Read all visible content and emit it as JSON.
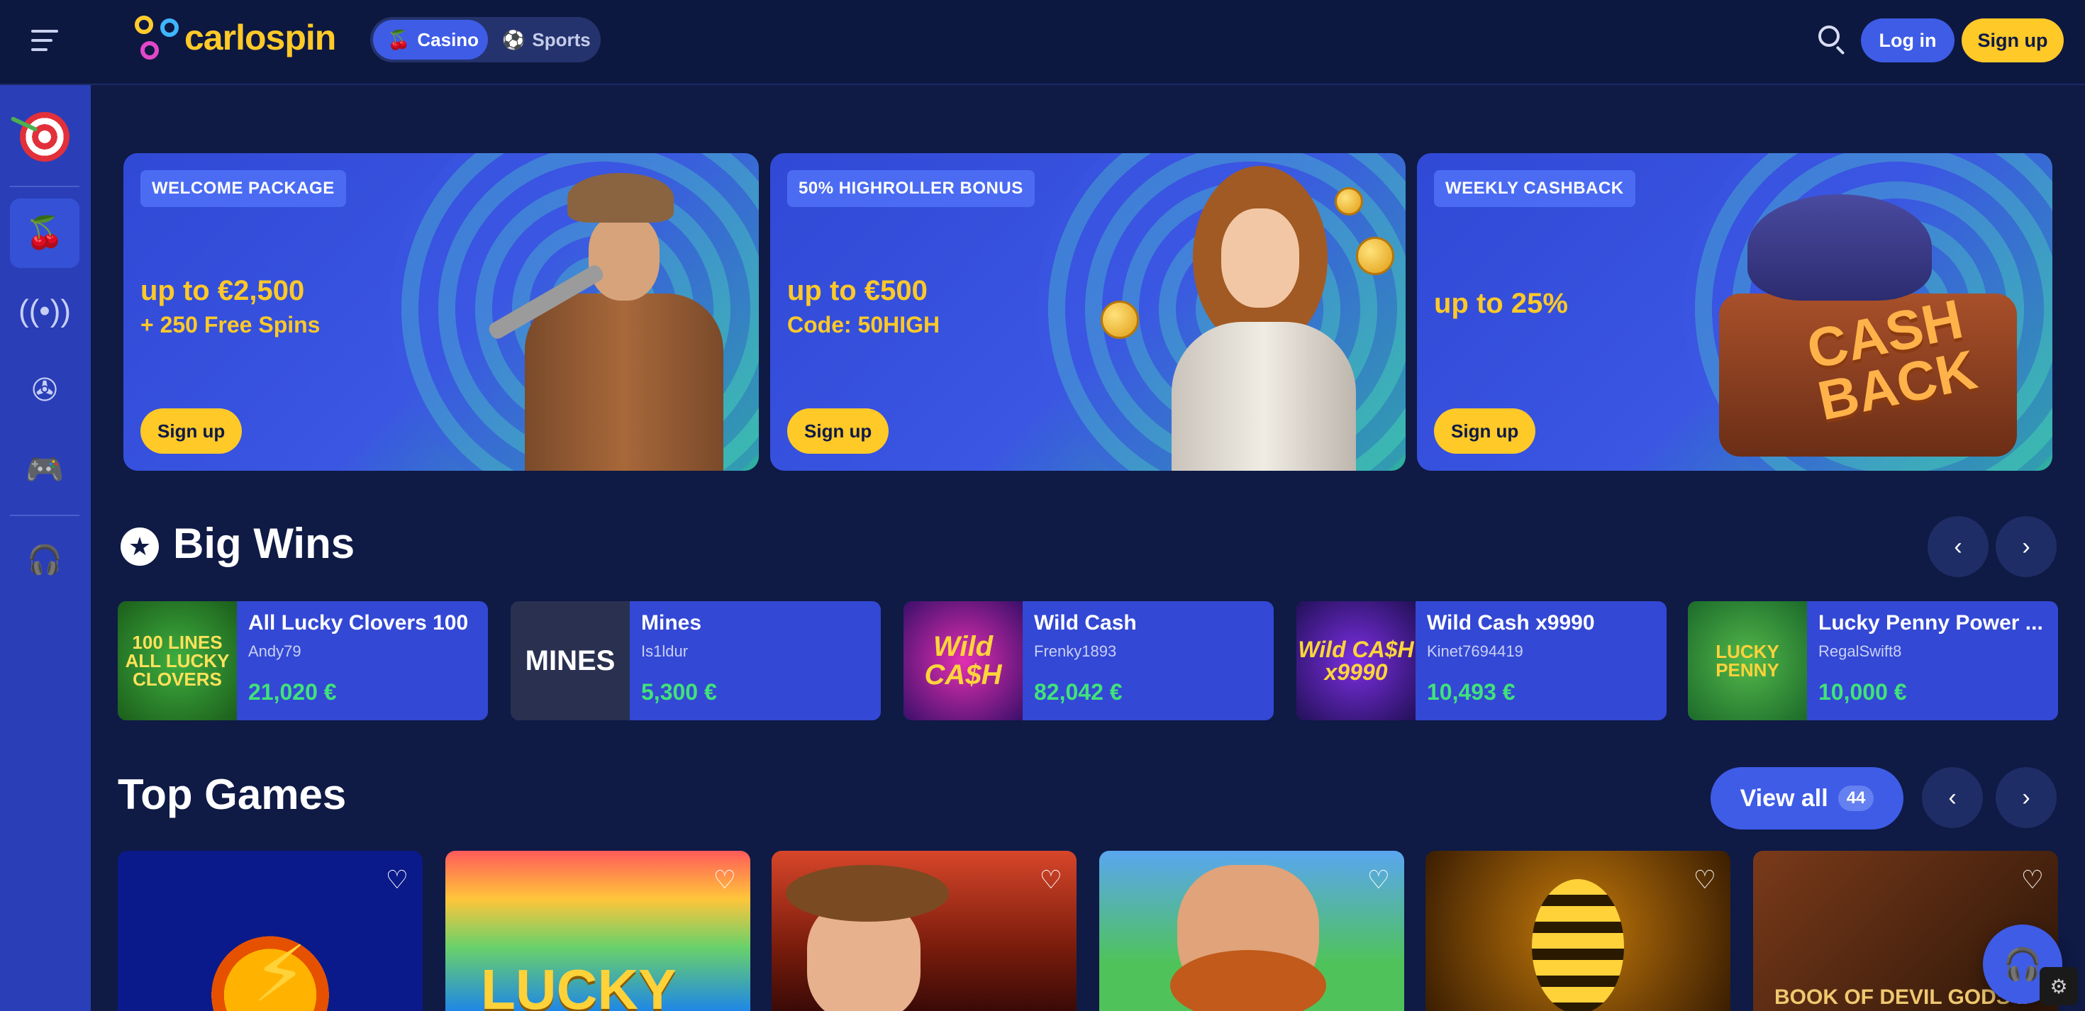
{
  "header": {
    "logo_text": "carlospin",
    "modes": [
      {
        "label": "Casino",
        "icon": "cherry-icon",
        "active": true
      },
      {
        "label": "Sports",
        "icon": "soccer-ball-icon",
        "active": false
      }
    ],
    "login_label": "Log in",
    "signup_label": "Sign up"
  },
  "sidebar": {
    "items": [
      {
        "icon": "darts-target-icon"
      },
      {
        "icon": "cherry-icon",
        "active": true
      },
      {
        "icon": "live-broadcast-icon"
      },
      {
        "icon": "film-reel-icon"
      },
      {
        "icon": "gamepad-icon"
      },
      {
        "icon": "headset-icon"
      }
    ]
  },
  "promos": [
    {
      "tag": "WELCOME PACKAGE",
      "amount": "up to €2,500",
      "sub": "+ 250 Free Spins",
      "cta": "Sign up"
    },
    {
      "tag": "50% HIGHROLLER BONUS",
      "amount": "up to €500",
      "sub": "Code: 50HIGH",
      "cta": "Sign up"
    },
    {
      "tag": "WEEKLY CASHBACK",
      "amount": "up to 25%",
      "sub": "",
      "cta": "Sign up",
      "art_text": "CASH BACK"
    }
  ],
  "big_wins": {
    "title": "Big Wins",
    "items": [
      {
        "game": "All Lucky Clovers 100",
        "user": "Andy79",
        "amount": "21,020 €",
        "thumb_text": "100 LINES ALL LUCKY CLOVERS"
      },
      {
        "game": "Mines",
        "user": "Is1ldur",
        "amount": "5,300 €",
        "thumb_text": "MINES"
      },
      {
        "game": "Wild Cash",
        "user": "Frenky1893",
        "amount": "82,042 €",
        "thumb_text": "Wild CA$H"
      },
      {
        "game": "Wild Cash x9990",
        "user": "Kinet7694419",
        "amount": "10,493 €",
        "thumb_text": "Wild CA$H x9990"
      },
      {
        "game": "Lucky Penny Power ...",
        "user": "RegalSwift8",
        "amount": "10,000 €",
        "thumb_text": "LUCKY PENNY"
      }
    ]
  },
  "top_games": {
    "title": "Top Games",
    "view_all_label": "View all",
    "count": "44",
    "tiles": [
      {
        "art_text": ""
      },
      {
        "art_text": "LUCKY"
      },
      {
        "art_text": ""
      },
      {
        "art_text": ""
      },
      {
        "art_text": ""
      },
      {
        "art_text": "BOOK OF DEVIL GODS II"
      }
    ]
  },
  "colors": {
    "background": "#0f1a45",
    "sidebar": "#2a3eb8",
    "accent": "#3e5ce6",
    "brand_yellow": "#ffc928",
    "win_green": "#41e27a"
  }
}
